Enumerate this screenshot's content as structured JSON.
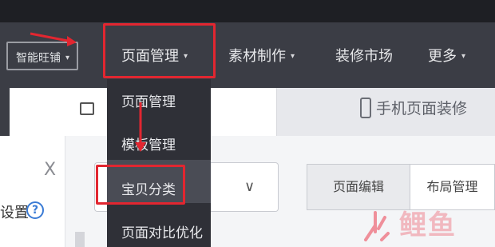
{
  "nav": {
    "store_label": "智能旺铺",
    "page_manage": "页面管理",
    "material": "素材制作",
    "decor_market": "装修市场",
    "more": "更多",
    "caret": "▾"
  },
  "dropdown": {
    "items": [
      "页面管理",
      "模板管理",
      "宝贝分类",
      "页面对比优化"
    ]
  },
  "tabs": {
    "mobile_decor": "手机页面装修"
  },
  "left": {
    "close": "X",
    "settings": "设置",
    "help": "?"
  },
  "content": {
    "select_chevron": "∨",
    "btn_edit": "页面编辑",
    "btn_layout": "布局管理"
  },
  "watermark": {
    "text": "鲤鱼"
  },
  "colors": {
    "highlight": "#e22630",
    "nav_bg": "#3b3d45",
    "dropdown_bg": "#2f3037"
  }
}
